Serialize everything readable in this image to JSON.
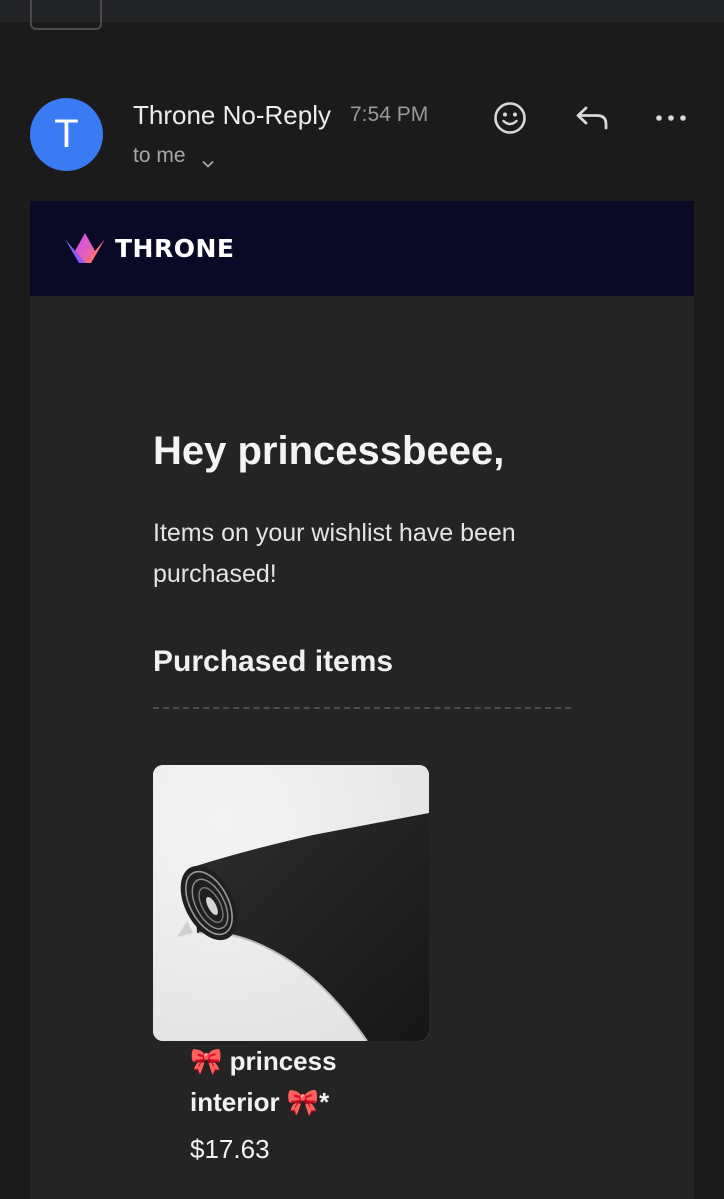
{
  "email": {
    "sender_initial": "T",
    "sender_name": "Throne No-Reply",
    "time": "7:54 PM",
    "recipient": "to me"
  },
  "icons": {
    "emoji": "smiley-face-icon",
    "reply": "reply-arrow-icon",
    "more": "more-dots-icon",
    "expand": "chevron-down-icon",
    "logo": "throne-crown-logo"
  },
  "brand": {
    "name": "THRONE",
    "banner_color": "#0a0a26",
    "avatar_color": "#3a7af2"
  },
  "body": {
    "greeting": "Hey princessbeee,",
    "message": "Items on your wishlist have been purchased!",
    "section_title": "Purchased items"
  },
  "items": [
    {
      "name": "🎀 princess interior 🎀*",
      "price": "$17.63",
      "image": "black velvet fabric roll"
    }
  ]
}
